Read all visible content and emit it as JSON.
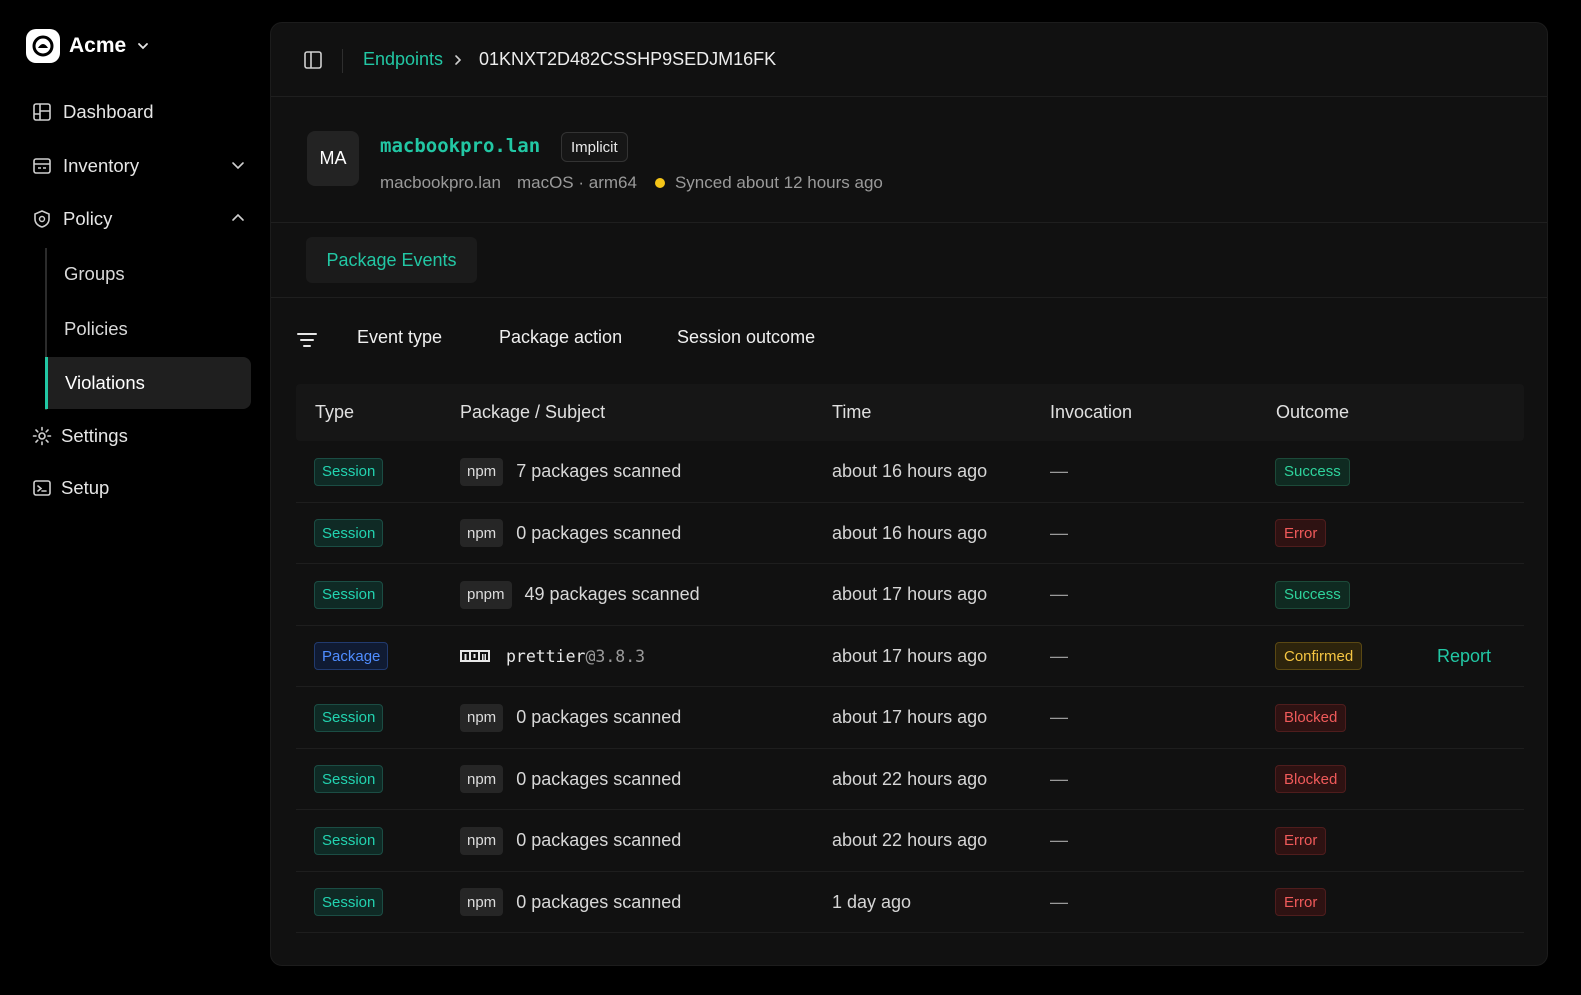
{
  "org": {
    "name": "Acme",
    "logo_icon": "acme-logo-icon"
  },
  "sidebar": {
    "items": [
      {
        "label": "Dashboard",
        "icon": "dashboard-icon"
      },
      {
        "label": "Inventory",
        "icon": "inventory-icon"
      },
      {
        "label": "Policy",
        "icon": "policy-icon"
      },
      {
        "label": "Settings",
        "icon": "gear-icon"
      },
      {
        "label": "Setup",
        "icon": "terminal-icon"
      }
    ],
    "policy_children": [
      "Groups",
      "Policies",
      "Violations"
    ],
    "active": "Violations"
  },
  "breadcrumb": {
    "parent": "Endpoints",
    "current": "01KNXT2D482CSSHP9SEDJM16FK"
  },
  "endpoint": {
    "initials": "MA",
    "hostname": "macbookpro.lan",
    "badge": "Implicit",
    "host_label": "macbookpro.lan",
    "platform": "macOS · arm64",
    "sync_status": "Synced about 12 hours ago",
    "sync_color": "#f5c518"
  },
  "tabs": [
    "Package Events"
  ],
  "filters": [
    "Event type",
    "Package action",
    "Session outcome"
  ],
  "table": {
    "columns": [
      "Type",
      "Package / Subject",
      "Time",
      "Invocation",
      "Outcome"
    ],
    "rows": [
      {
        "type": "Session",
        "pm": "npm",
        "subject": "7 packages scanned",
        "time": "about 16 hours ago",
        "invocation": "—",
        "outcome": "Success",
        "action": ""
      },
      {
        "type": "Session",
        "pm": "npm",
        "subject": "0 packages scanned",
        "time": "about 16 hours ago",
        "invocation": "—",
        "outcome": "Error",
        "action": ""
      },
      {
        "type": "Session",
        "pm": "pnpm",
        "subject": "49 packages scanned",
        "time": "about 17 hours ago",
        "invocation": "—",
        "outcome": "Success",
        "action": ""
      },
      {
        "type": "Package",
        "pm": "npm",
        "pkg_name": "prettier",
        "pkg_version": "@3.8.3",
        "time": "about 17 hours ago",
        "invocation": "—",
        "outcome": "Confirmed",
        "action": "Report"
      },
      {
        "type": "Session",
        "pm": "npm",
        "subject": "0 packages scanned",
        "time": "about 17 hours ago",
        "invocation": "—",
        "outcome": "Blocked",
        "action": ""
      },
      {
        "type": "Session",
        "pm": "npm",
        "subject": "0 packages scanned",
        "time": "about 22 hours ago",
        "invocation": "—",
        "outcome": "Blocked",
        "action": ""
      },
      {
        "type": "Session",
        "pm": "npm",
        "subject": "0 packages scanned",
        "time": "about 22 hours ago",
        "invocation": "—",
        "outcome": "Error",
        "action": ""
      },
      {
        "type": "Session",
        "pm": "npm",
        "subject": "0 packages scanned",
        "time": "1 day ago",
        "invocation": "—",
        "outcome": "Error",
        "action": ""
      }
    ]
  },
  "colors": {
    "accent": "#22c7a4",
    "background": "#000000",
    "panel": "#111111"
  }
}
